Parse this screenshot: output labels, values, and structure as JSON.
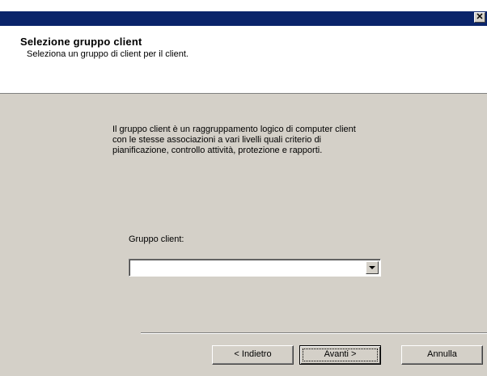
{
  "window": {
    "close_glyph": "✕"
  },
  "header": {
    "title": "Selezione gruppo client",
    "subtitle": "Seleziona un gruppo di client per il client."
  },
  "content": {
    "description_lines": [
      "Il gruppo client è un raggruppamento logico di computer client",
      "con le stesse associazioni a vari livelli quali criterio di",
      "pianificazione, controllo attività, protezione e rapporti."
    ],
    "group_label": "Gruppo client:",
    "group_value": ""
  },
  "buttons": {
    "back": "< Indietro",
    "next": "Avanti >",
    "cancel": "Annulla"
  }
}
